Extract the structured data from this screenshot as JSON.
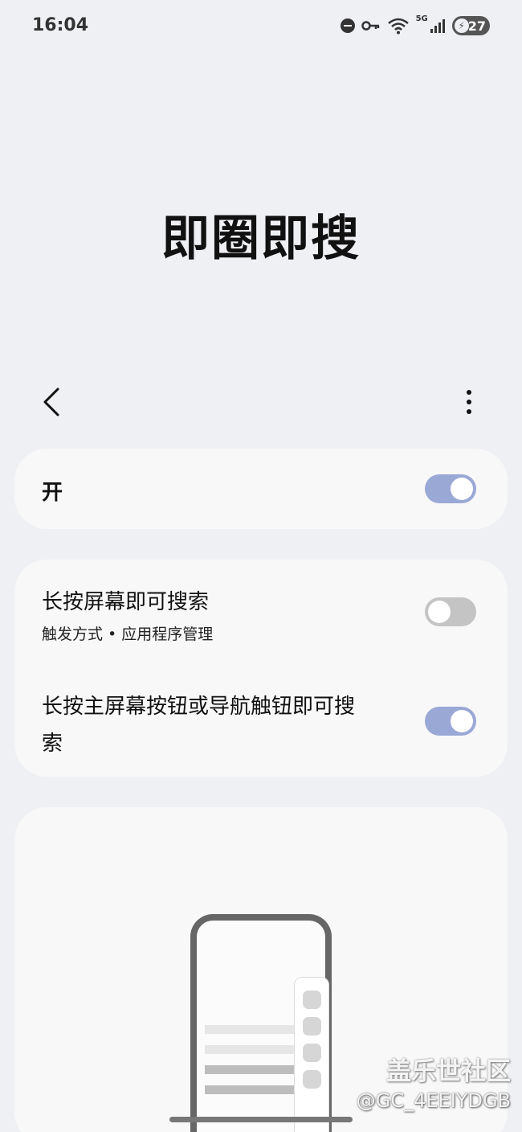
{
  "status_bar": {
    "time": "16:04",
    "network": "5G",
    "battery": "27",
    "icons": [
      "do-not-disturb-icon",
      "vpn-key-icon",
      "wifi-icon",
      "cellular-signal-icon",
      "battery-icon"
    ]
  },
  "header": {
    "title": "即圈即搜",
    "back_icon": "chevron-left-icon",
    "more_icon": "more-vert-icon"
  },
  "master_switch": {
    "label": "开",
    "state": "on"
  },
  "options": [
    {
      "label": "长按屏幕即可搜索",
      "sublabel": "触发方式 • 应用程序管理",
      "state": "off"
    },
    {
      "label_line1": "长按主屏幕按钮或导航触钮即可搜",
      "label_line2": "索",
      "state": "on"
    }
  ],
  "watermark": {
    "site": "盖乐世社区",
    "user": "@GC_4EEIYDGB"
  },
  "colors": {
    "background": "#eef0f4",
    "card": "#f8f8f8",
    "toggle_on": "#9aa8d6",
    "toggle_off": "#c4c4c4"
  }
}
